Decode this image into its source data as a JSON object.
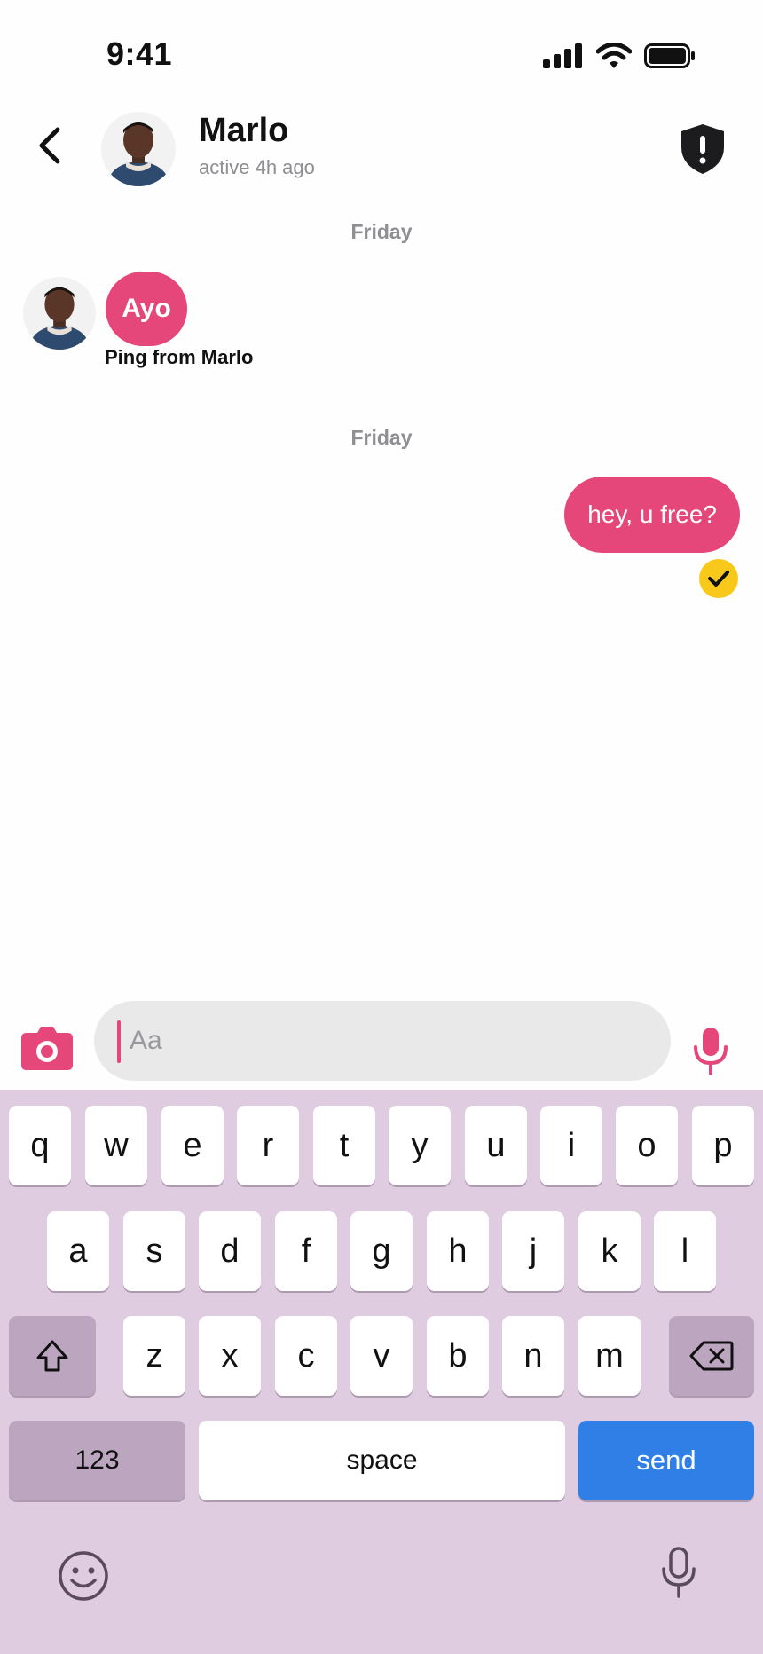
{
  "status_bar": {
    "time": "9:41"
  },
  "header": {
    "contact_name": "Marlo",
    "contact_status": "active 4h ago"
  },
  "messages": {
    "day_label_1": "Friday",
    "ping_label": "Ayo",
    "ping_caption": "Ping from Marlo",
    "day_label_2": "Friday",
    "outgoing_text": "hey, u free?"
  },
  "composer": {
    "placeholder": "Aa"
  },
  "keyboard": {
    "row1": [
      "q",
      "w",
      "e",
      "r",
      "t",
      "y",
      "u",
      "i",
      "o",
      "p"
    ],
    "row2": [
      "a",
      "s",
      "d",
      "f",
      "g",
      "h",
      "j",
      "k",
      "l"
    ],
    "row3": [
      "z",
      "x",
      "c",
      "v",
      "b",
      "n",
      "m"
    ],
    "numbers_label": "123",
    "space_label": "space",
    "send_label": "send"
  },
  "colors": {
    "accent": "#e5477a",
    "keyboard_bg": "#dfcce0",
    "send_blue": "#2f7fe6",
    "receipt_yellow": "#f8c91a"
  }
}
